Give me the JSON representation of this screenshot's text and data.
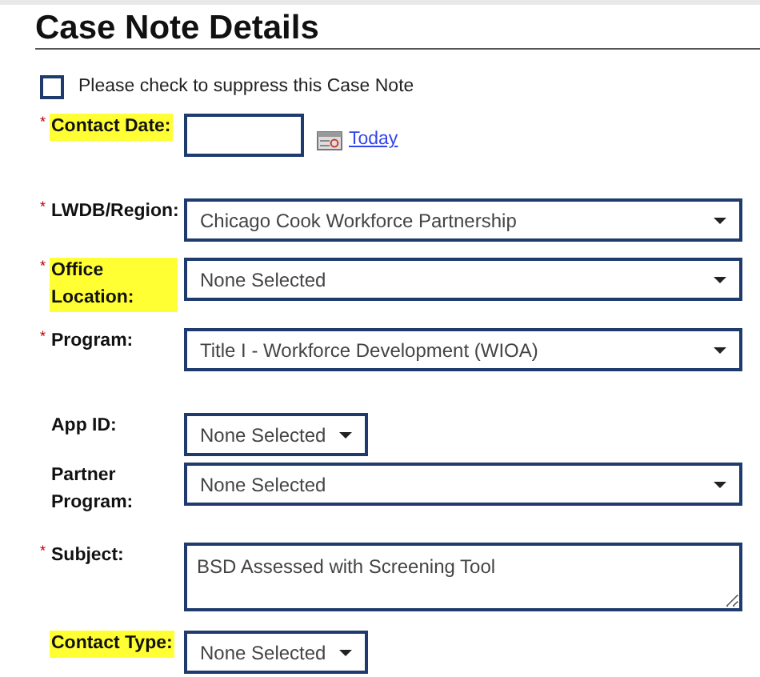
{
  "heading": "Case Note Details",
  "suppress": {
    "label": "Please check to suppress this Case Note",
    "checked": false
  },
  "fields": [
    {
      "label": "Contact Date:",
      "required_mark": "*",
      "highlighted": true,
      "kind": "date",
      "link": "Today"
    },
    {
      "label": "LWDB/Region:",
      "required_mark": "*",
      "highlighted": false,
      "kind": "select",
      "value": "Chicago Cook Workforce Partnership",
      "wide": true
    },
    {
      "label": "Office Location:",
      "required_mark": "*",
      "highlighted": true,
      "kind": "select",
      "value": "None Selected",
      "wide": true
    },
    {
      "label": "Program:",
      "required_mark": "*",
      "highlighted": false,
      "kind": "select",
      "value": "Title I - Workforce Development (WIOA)",
      "wide": true
    },
    {
      "label": "App ID:",
      "highlighted": false,
      "kind": "select",
      "value": "None Selected",
      "wide": false
    },
    {
      "label": "Partner Program:",
      "highlighted": false,
      "kind": "select",
      "value": "None Selected",
      "wide": true
    },
    {
      "label": "Subject:",
      "required_mark": "*",
      "highlighted": false,
      "kind": "textarea",
      "value": "BSD Assessed with Screening Tool"
    },
    {
      "label": "Contact Type:",
      "highlighted": true,
      "kind": "select",
      "value": "None Selected",
      "wide": false
    }
  ]
}
